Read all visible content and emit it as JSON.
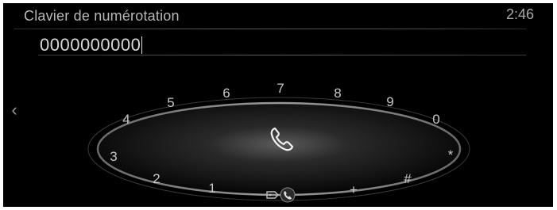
{
  "header": {
    "title": "Clavier de numérotation",
    "clock": "2:46"
  },
  "dial_input": {
    "value": "0000000000"
  },
  "nav": {
    "back_icon": "chevron-left-icon"
  },
  "wheel": {
    "keys": [
      "1",
      "2",
      "3",
      "4",
      "5",
      "6",
      "7",
      "8",
      "9",
      "0",
      "*",
      "#",
      "+"
    ],
    "center_icon": "phone-handset-icon",
    "bottom_icons": [
      "keypad-toggle-icon",
      "phone-handset-icon"
    ]
  },
  "colors": {
    "background": "#000000",
    "text": "#c8c8c8",
    "ring_glow": "#7a7a7a"
  }
}
